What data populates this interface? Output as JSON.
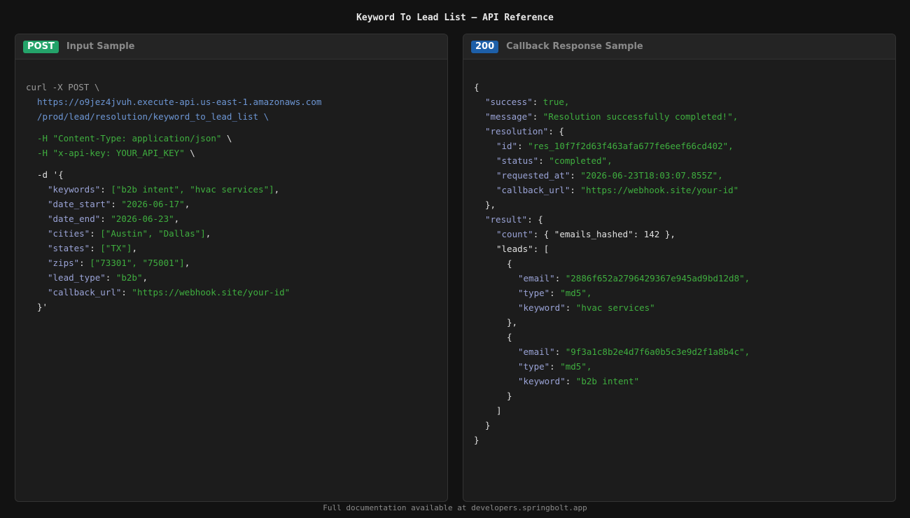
{
  "page": {
    "title": "Keyword To Lead List — API Reference",
    "footer": "Full documentation available at developers.springbolt.app"
  },
  "input_panel": {
    "badge": "POST",
    "title": "Input Sample",
    "curl": {
      "cmd": "curl -X POST \\",
      "url_line1": "https://o9jez4jvuh.execute-api.us-east-1.amazonaws.com",
      "url_line2": "/prod/lead/resolution/keyword_to_lead_list \\",
      "header1_flag": "-H ",
      "header1": "\"Content-Type: application/json\"",
      "header1_cont": " \\",
      "header2_flag": "-H ",
      "header2": "\"x-api-key: YOUR_API_KEY\"",
      "header2_cont": " \\",
      "data_open": "-d '{",
      "data_close": "}'"
    },
    "body_fields": [
      {
        "key": "\"keywords\"",
        "value": "[\"b2b intent\", \"hvac services\"]",
        "comma": ","
      },
      {
        "key": "\"date_start\"",
        "value": "\"2026-06-17\"",
        "comma": ","
      },
      {
        "key": "\"date_end\"",
        "value": "\"2026-06-23\"",
        "comma": ","
      },
      {
        "key": "\"cities\"",
        "value": "[\"Austin\", \"Dallas\"]",
        "comma": ","
      },
      {
        "key": "\"states\"",
        "value": "[\"TX\"]",
        "comma": ","
      },
      {
        "key": "\"zips\"",
        "value": "[\"73301\", \"75001\"]",
        "comma": ","
      },
      {
        "key": "\"lead_type\"",
        "value": "\"b2b\"",
        "comma": ","
      },
      {
        "key": "\"callback_url\"",
        "value": "\"https://webhook.site/your-id\"",
        "comma": ""
      }
    ]
  },
  "response_panel": {
    "badge": "200",
    "title": "Callback Response Sample",
    "success_key": "\"success\"",
    "success_val": "true,",
    "message_key": "\"message\"",
    "message_val": "\"Resolution successfully completed!\",",
    "resolution_key": "\"resolution\"",
    "resolution": {
      "id_key": "\"id\"",
      "id_val": "\"res_10f7f2d63f463afa677fe6eef66cd402\",",
      "status_key": "\"status\"",
      "status_val": "\"completed\",",
      "requested_key": "\"requested_at\"",
      "requested_val": "\"2026-06-23T18:03:07.855Z\",",
      "callback_key": "\"callback_url\"",
      "callback_val": "\"https://webhook.site/your-id\""
    },
    "result_key": "\"result\"",
    "count_key": "\"count\"",
    "emails_hashed_key": "\"emails_hashed\"",
    "emails_hashed_val": "142",
    "leads_key": "\"leads\"",
    "leads": [
      {
        "email_key": "\"email\"",
        "email_val": "\"2886f652a2796429367e945ad9bd12d8\",",
        "type_key": "\"type\"",
        "type_val": "\"md5\",",
        "keyword_key": "\"keyword\"",
        "keyword_val": "\"hvac services\""
      },
      {
        "email_key": "\"email\"",
        "email_val": "\"9f3a1c8b2e4d7f6a0b5c3e9d2f1a8b4c\",",
        "type_key": "\"type\"",
        "type_val": "\"md5\",",
        "keyword_key": "\"keyword\"",
        "keyword_val": "\"b2b intent\""
      }
    ]
  }
}
